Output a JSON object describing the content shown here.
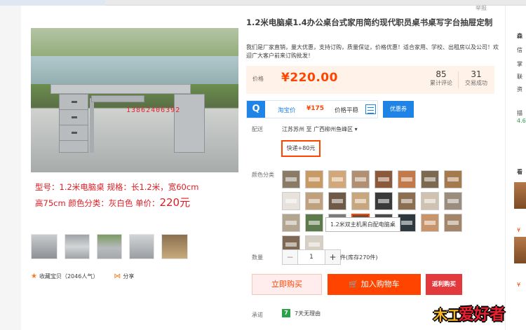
{
  "report_label": "举报",
  "product": {
    "title": "1.2米电脑桌1.4办公桌台式家用简约现代职员桌书桌写字台抽屉定制",
    "subtitle": "我们是厂家直销，量大优惠，支持订购，质量保证，价格优惠！适合家用、学校、出租房以及公司！欢迎广大客户前来订购批发！",
    "image_phone_text": "13862406392",
    "spec_line1": "型号：1.2米电脑桌   规格：长1.2米，宽60cm",
    "spec_line2_a": "高75cm   颜色分类：灰白色   单价：",
    "spec_line2_b": "220元"
  },
  "gallery": {
    "favorite_label": "收藏宝贝（2046人气）",
    "share_label": "分享"
  },
  "price": {
    "label": "价格",
    "value": "¥220.00",
    "reviews_count": "85",
    "reviews_label": "累计评论",
    "sales_count": "31",
    "sales_label": "交易成功"
  },
  "taobao_price": {
    "label": "淘宝价",
    "value": "¥175",
    "trend_label": "价格平稳",
    "coupon_label": "优惠券"
  },
  "shipping": {
    "label": "配送",
    "from_to": "江苏苏州 至  广西柳州鱼峰区  ▾",
    "express_option": "快递+80元"
  },
  "color": {
    "label": "颜色分类",
    "tooltip": "1.2米双主机黑白配电脑桌",
    "swatch_colors": [
      "#8a7a66",
      "#c89b66",
      "#d2a87a",
      "#b09070",
      "#8c5a3a",
      "#c27a4a",
      "#7d6850",
      "#a67a4f",
      "#e7e2dc",
      "#bfa27d",
      "#6f5a48",
      "#c9a77c",
      "#3a3a3a",
      "#8c6f50",
      "#d0c2b0",
      "#9a8d7e",
      "#b4a591",
      "#5c7a4c",
      "#7a7a7a",
      "#6a4e3a",
      "#4a4a4a",
      "#2f3a40",
      "#c8946a",
      "#a3866a",
      "#7e6a54",
      "#d8cfc4"
    ],
    "selected_index": 19
  },
  "quantity": {
    "label": "数量",
    "value": "1",
    "stock_text": "件(库存270件)"
  },
  "buttons": {
    "buy_now": "立即购买",
    "add_to_cart": "加入购物车",
    "cashback": "返利购买"
  },
  "promise": {
    "label": "承诺",
    "badge": "7",
    "text": "7天无理由"
  },
  "sidebar": {
    "lines": [
      "森",
      "信",
      "掌",
      "联",
      "资",
      "描",
      "4.6",
      "看"
    ],
    "yen": "¥"
  },
  "watermark": {
    "part1": "木工",
    "part2": "爱好者"
  }
}
